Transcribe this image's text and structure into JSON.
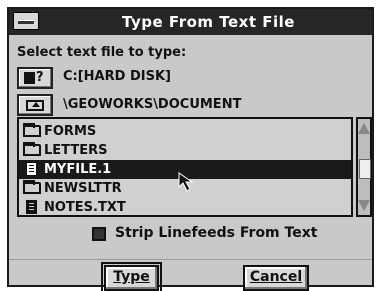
{
  "dialog": {
    "title": "Type From Text File",
    "prompt": "Select text file to type:",
    "drive_path": "C:[HARD DISK]",
    "directory_path": "\\GEOWORKS\\DOCUMENT",
    "files": [
      {
        "name": "FORMS",
        "icon": "folder-icon",
        "selected": false
      },
      {
        "name": "LETTERS",
        "icon": "folder-icon",
        "selected": false
      },
      {
        "name": "MYFILE.1",
        "icon": "document-icon",
        "selected": true
      },
      {
        "name": "NEWSLTTR",
        "icon": "folder-icon",
        "selected": false
      },
      {
        "name": "NOTES.TXT",
        "icon": "document-icon",
        "selected": false
      }
    ],
    "drive_button_label": "?",
    "checkbox_label": "Strip Linefeeds From Text",
    "checkbox_checked": true,
    "type_button": "Type",
    "cancel_button": "Cancel"
  },
  "colors": {
    "titlebar": "#262626",
    "dialog_bg": "#c9c9c9",
    "selection": "#1a1a1a"
  }
}
